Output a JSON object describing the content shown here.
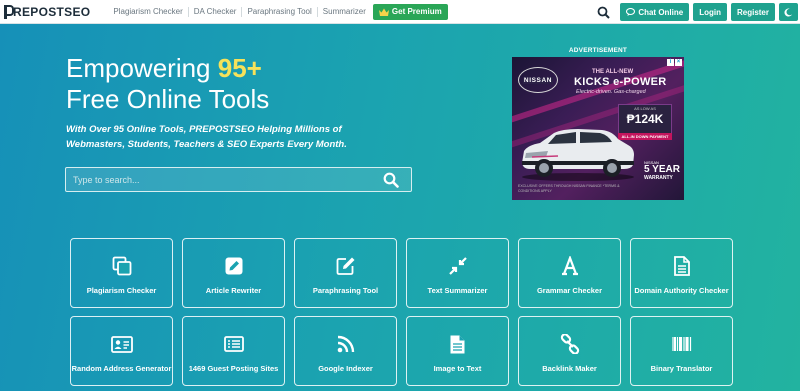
{
  "navbar": {
    "logo_text": "REPOSTSEO",
    "links": [
      "Plagiarism Checker",
      "DA Checker",
      "Paraphrasing Tool",
      "Summarizer"
    ],
    "premium_label": "Get Premium",
    "chat_label": "Chat Online",
    "login_label": "Login",
    "register_label": "Register"
  },
  "hero": {
    "title_line1_prefix": "Empowering ",
    "title_highlight": "95+",
    "title_line2": "Free Online Tools",
    "subtitle": "With Over 95 Online Tools, PREPOSTSEO Helping Millions of Webmasters, Students, Teachers & SEO Experts Every Month.",
    "search_placeholder": "Type to search..."
  },
  "advertisement": {
    "label": "ADVERTISEMENT",
    "brand": "NISSAN",
    "kicker": "THE ALL-NEW",
    "headline": "KICKS e-POWER",
    "tagline": "Electric-driven. Gas-charged",
    "price_label": "AS LOW AS",
    "price": "₱124K",
    "price_badge": "ALL-IN DOWN PAYMENT",
    "warranty_top": "NISSAN",
    "warranty_number": "5 YEAR",
    "warranty_bottom": "WARRANTY",
    "disclaimer": "EXCLUSIVE OFFERS THROUGH NISSAN FINANCE *TERMS & CONDITIONS APPLY"
  },
  "tools": [
    {
      "label": "Plagiarism Checker",
      "icon": "copy-icon"
    },
    {
      "label": "Article Rewriter",
      "icon": "pencil-square-icon"
    },
    {
      "label": "Paraphrasing Tool",
      "icon": "edit-icon"
    },
    {
      "label": "Text Summarizer",
      "icon": "compress-icon"
    },
    {
      "label": "Grammar Checker",
      "icon": "font-icon"
    },
    {
      "label": "Domain Authority Checker",
      "icon": "document-icon"
    },
    {
      "label": "Random Address Generator",
      "icon": "address-card-icon"
    },
    {
      "label": "1469 Guest Posting Sites",
      "icon": "list-icon"
    },
    {
      "label": "Google Indexer",
      "icon": "rss-icon"
    },
    {
      "label": "Image to Text",
      "icon": "file-icon"
    },
    {
      "label": "Backlink Maker",
      "icon": "link-icon"
    },
    {
      "label": "Binary Translator",
      "icon": "barcode-icon"
    }
  ],
  "colors": {
    "background_start": "#1690b8",
    "background_end": "#22b3a0",
    "highlight": "#f6e25a",
    "premium_green": "#2aa657",
    "nav_button": "#1fa28f"
  }
}
